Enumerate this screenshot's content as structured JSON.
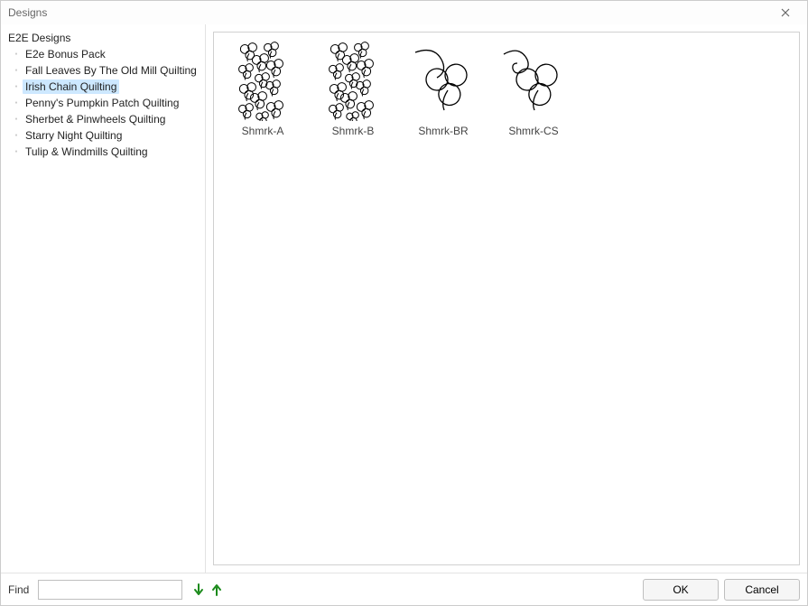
{
  "window": {
    "title": "Designs"
  },
  "tree": {
    "root": "E2E Designs",
    "items": [
      {
        "label": "E2e Bonus Pack",
        "selected": false
      },
      {
        "label": "Fall Leaves By The Old Mill Quilting",
        "selected": false
      },
      {
        "label": "Irish Chain Quilting",
        "selected": true
      },
      {
        "label": "Penny's Pumpkin Patch Quilting",
        "selected": false
      },
      {
        "label": "Sherbet & Pinwheels Quilting",
        "selected": false
      },
      {
        "label": "Starry Night Quilting",
        "selected": false
      },
      {
        "label": "Tulip & Windmills Quilting",
        "selected": false
      }
    ]
  },
  "thumbnails": [
    {
      "name": "Shmrk-A"
    },
    {
      "name": "Shmrk-B"
    },
    {
      "name": "Shmrk-BR"
    },
    {
      "name": "Shmrk-CS"
    }
  ],
  "footer": {
    "find_label": "Find",
    "find_value": "",
    "ok_label": "OK",
    "cancel_label": "Cancel"
  }
}
